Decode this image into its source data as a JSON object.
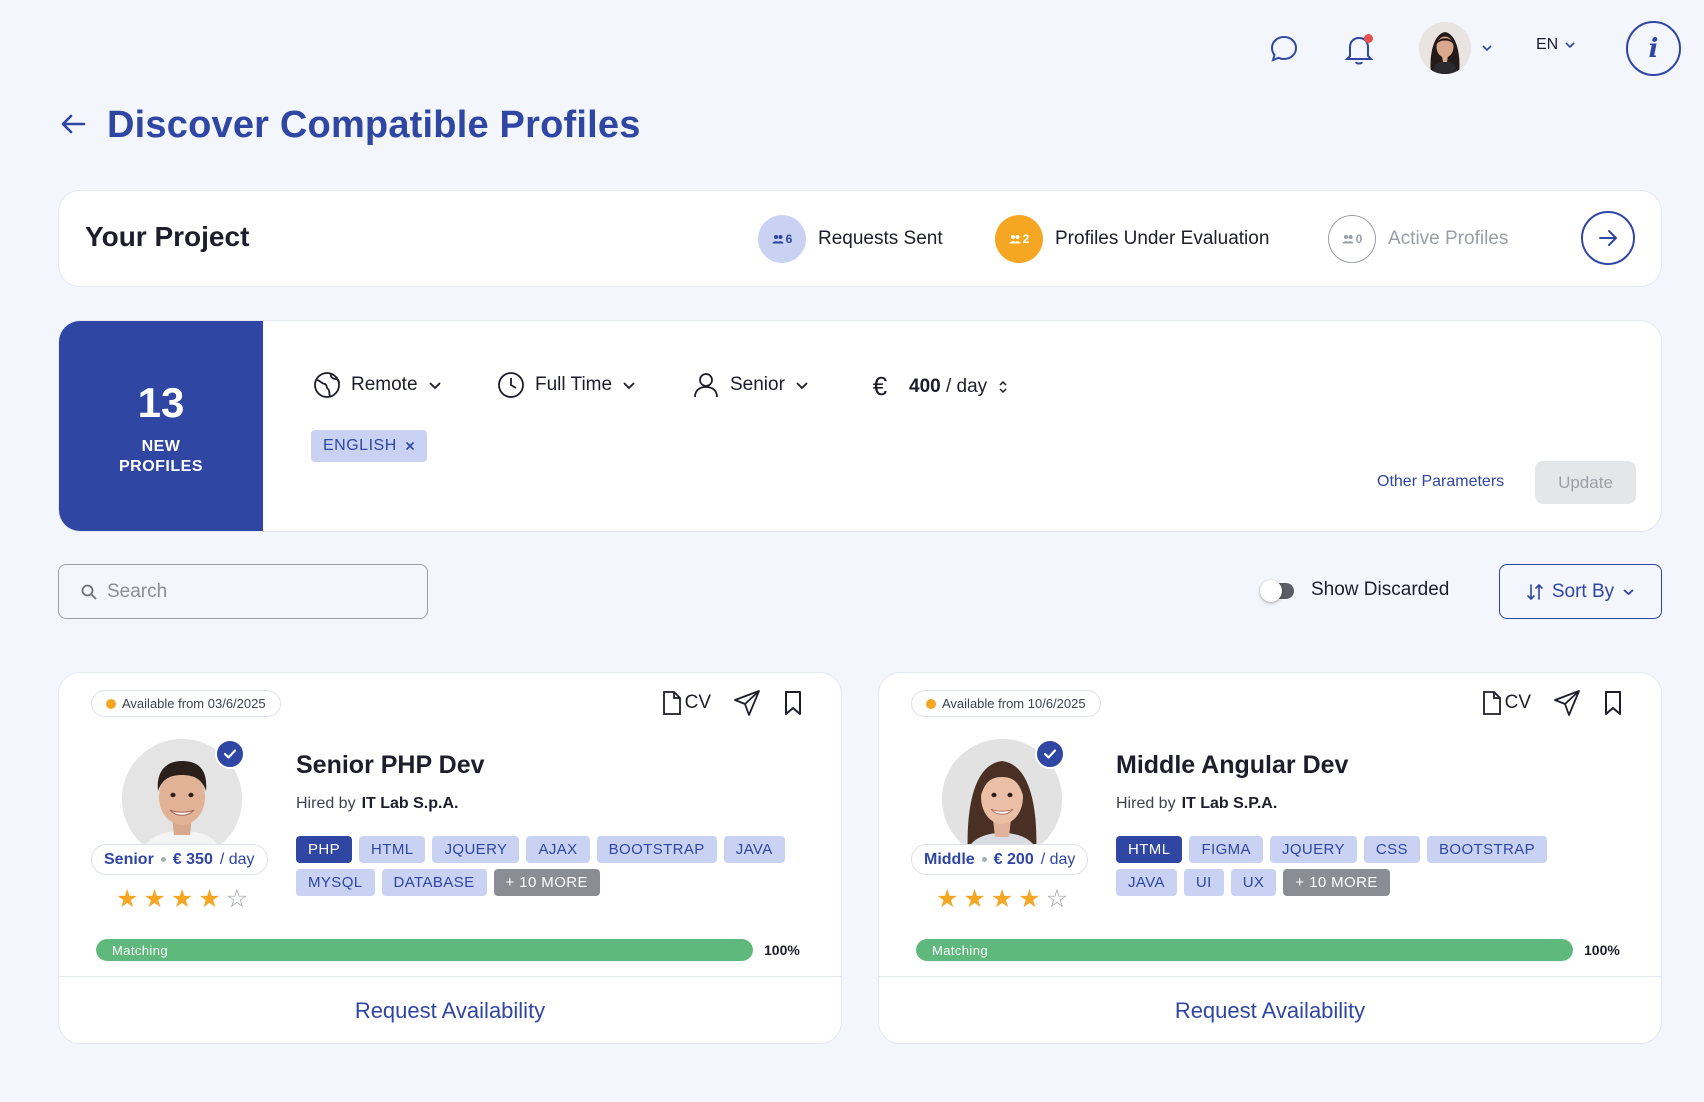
{
  "header": {
    "language": "EN",
    "info_symbol": "i",
    "icons": [
      "chat-icon",
      "bell-icon",
      "user-avatar",
      "info-icon"
    ],
    "notification_dot_color": "#e8504e"
  },
  "page": {
    "title": "Discover Compatible Profiles"
  },
  "project": {
    "title": "Your Project",
    "stats": [
      {
        "count": "6",
        "label": "Requests Sent",
        "circle_bg": "#c9d2f2",
        "circle_fg": "#2f46a3",
        "text_color": "#1d1d2b"
      },
      {
        "count": "2",
        "label": "Profiles Under Evaluation",
        "circle_bg": "#f5a623",
        "circle_fg": "#ffffff",
        "text_color": "#1d1d2b"
      },
      {
        "count": "0",
        "label": "Active Profiles",
        "circle_bg": "#ffffff",
        "circle_fg": "#9a9ea6",
        "text_color": "#9a9ea6"
      }
    ]
  },
  "filters": {
    "new_profiles_count": "13",
    "new_profiles_label_1": "NEW",
    "new_profiles_label_2": "PROFILES",
    "work_mode": "Remote",
    "schedule": "Full Time",
    "seniority": "Senior",
    "currency_symbol": "€",
    "rate_value": "400",
    "rate_unit": "/ day",
    "language_chip": "ENGLISH",
    "other_parameters": "Other Parameters",
    "update_label": "Update"
  },
  "toolbar": {
    "search_placeholder": "Search",
    "show_discarded": "Show Discarded",
    "show_discarded_on": false,
    "sort_label": "Sort By"
  },
  "profiles": [
    {
      "availability": "Available from 03/6/2025",
      "cv_label": "CV",
      "role": "Senior PHP Dev",
      "hired_by_label": "Hired by",
      "hired_by": "IT Lab S.p.A.",
      "level": "Senior",
      "rate": "€ 350",
      "rate_unit": "/ day",
      "rating": 4,
      "rating_max": 5,
      "skills": [
        "PHP",
        "HTML",
        "JQUERY",
        "AJAX",
        "BOOTSTRAP",
        "JAVA",
        "MYSQL",
        "DATABASE",
        "+ 10 MORE"
      ],
      "match_label": "Matching",
      "match_percent": 100,
      "match_text": "100%",
      "request_label": "Request Availability"
    },
    {
      "availability": "Available from 10/6/2025",
      "cv_label": "CV",
      "role": "Middle Angular Dev",
      "hired_by_label": "Hired by",
      "hired_by": "IT Lab S.P.A.",
      "level": "Middle",
      "rate": "€ 200",
      "rate_unit": "/ day",
      "rating": 4,
      "rating_max": 5,
      "skills": [
        "HTML",
        "FIGMA",
        "JQUERY",
        "CSS",
        "BOOTSTRAP",
        "JAVA",
        "UI",
        "UX",
        "+ 10 MORE"
      ],
      "match_label": "Matching",
      "match_percent": 100,
      "match_text": "100%",
      "request_label": "Request Availability"
    }
  ],
  "colors": {
    "primary": "#2f46a3",
    "accent_orange": "#f5a623",
    "match_green": "#5fb97d",
    "background": "#f3f6fc"
  }
}
